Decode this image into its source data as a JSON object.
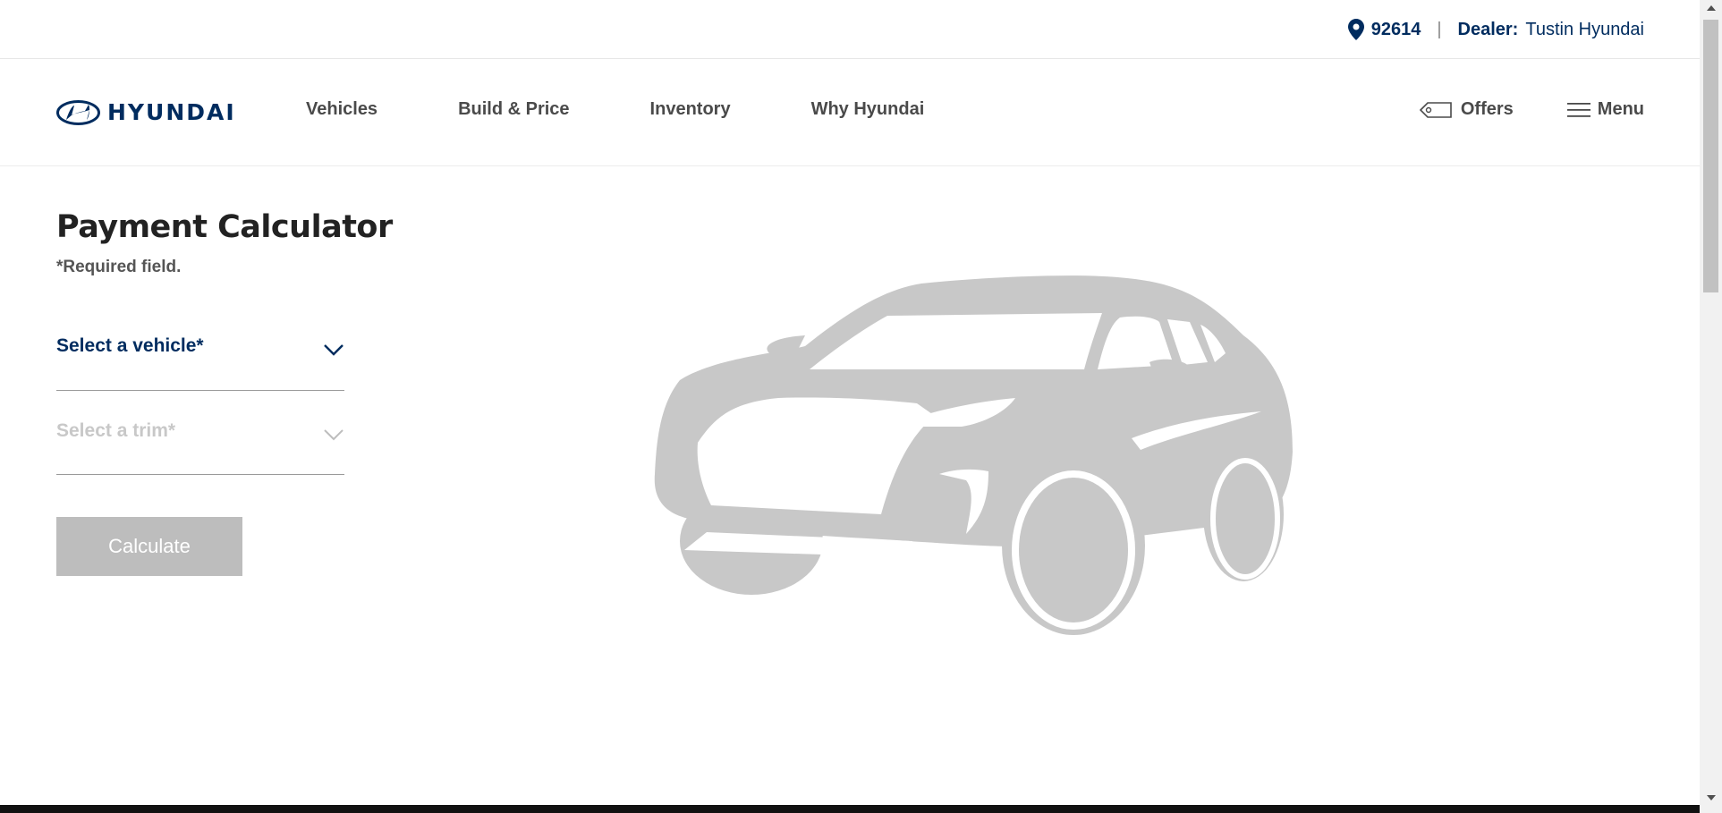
{
  "util_bar": {
    "zip": "92614",
    "separator": "|",
    "dealer_label": "Dealer:",
    "dealer_name": "Tustin Hyundai",
    "icon": "location-pin-icon"
  },
  "header": {
    "logo_text": "HYUNDAI",
    "nav": [
      {
        "label": "Vehicles"
      },
      {
        "label": "Build & Price"
      },
      {
        "label": "Inventory"
      },
      {
        "label": "Why Hyundai"
      }
    ],
    "offers_label": "Offers",
    "offers_icon": "tag-icon",
    "menu_label": "Menu",
    "menu_icon": "hamburger-icon"
  },
  "calculator": {
    "title": "Payment Calculator",
    "required_note": "*Required field.",
    "vehicle_select": {
      "label": "Select a vehicle*"
    },
    "trim_select": {
      "label": "Select a trim*"
    },
    "calculate_label": "Calculate"
  },
  "colors": {
    "brand": "#002c5f",
    "nav_text": "#4a4a4a",
    "button_disabled": "#bdbdbd",
    "car_placeholder": "#c8c8c8"
  }
}
